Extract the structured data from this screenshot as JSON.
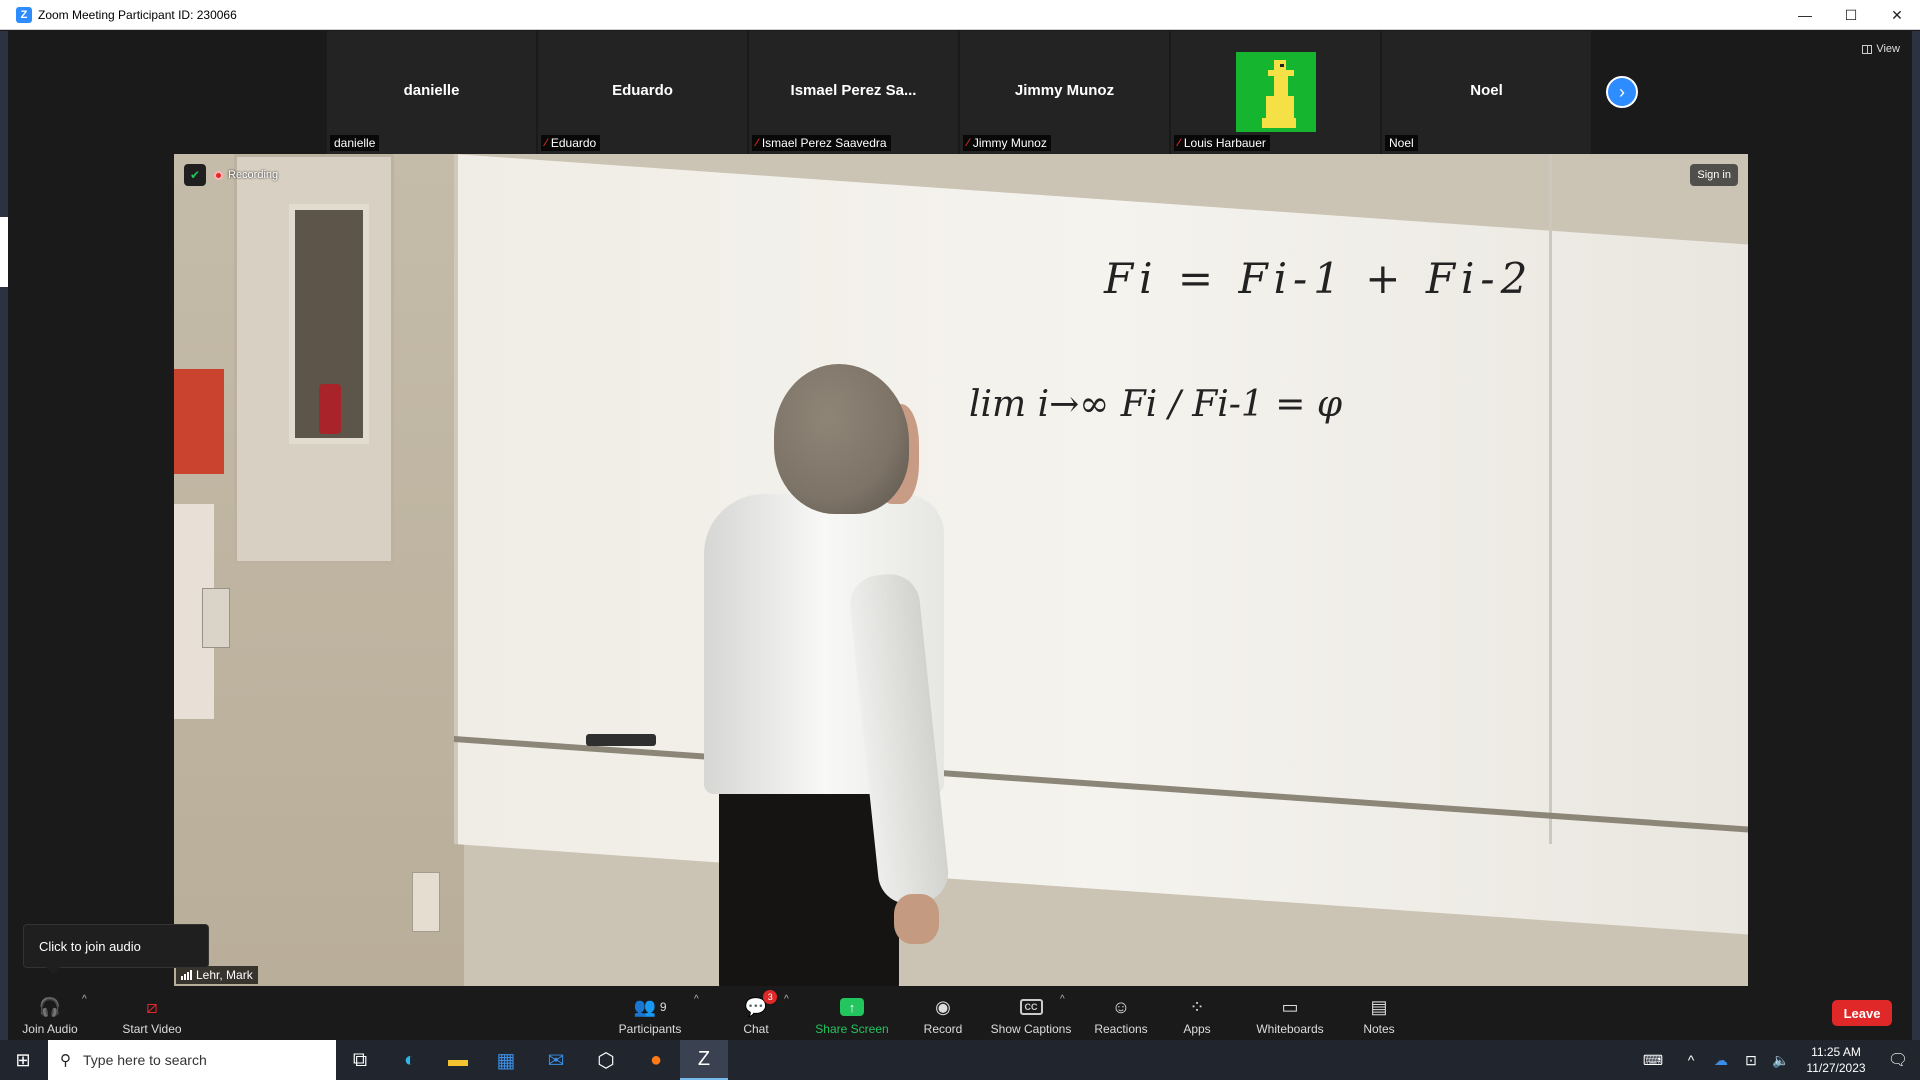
{
  "window": {
    "title": "Zoom Meeting Participant ID: 230066",
    "minimize_glyph": "—",
    "maximize_glyph": "☐",
    "close_glyph": "✕"
  },
  "view_button": {
    "label": "View"
  },
  "participants_strip": [
    {
      "display_name": "danielle",
      "tag": "danielle",
      "muted": false,
      "has_avatar": false
    },
    {
      "display_name": "Eduardo",
      "tag": "Eduardo",
      "muted": true,
      "has_avatar": false
    },
    {
      "display_name": "Ismael Perez Sa...",
      "tag": "Ismael Perez Saavedra",
      "muted": true,
      "has_avatar": false
    },
    {
      "display_name": "Jimmy Munoz",
      "tag": "Jimmy Munoz",
      "muted": true,
      "has_avatar": false
    },
    {
      "display_name": "",
      "tag": "Louis Harbauer",
      "muted": true,
      "has_avatar": true
    },
    {
      "display_name": "Noel",
      "tag": "Noel",
      "muted": false,
      "has_avatar": false
    }
  ],
  "main_video": {
    "recording_label": "Recording",
    "sign_in_label": "Sign in",
    "speaker_name": "Lehr, Mark",
    "board_formula_1": "Fi = Fi-1 + Fi-2",
    "board_formula_2": "lim i→∞  Fi / Fi-1 = φ"
  },
  "tooltip": {
    "text": "Click to join audio"
  },
  "toolbar": {
    "join_audio": "Join Audio",
    "start_video": "Start Video",
    "participants": "Participants",
    "participants_count": "9",
    "chat": "Chat",
    "chat_badge": "3",
    "share_screen": "Share Screen",
    "record": "Record",
    "show_captions": "Show Captions",
    "captions_icon_text": "CC",
    "reactions": "Reactions",
    "apps": "Apps",
    "whiteboards": "Whiteboards",
    "notes": "Notes",
    "leave": "Leave"
  },
  "taskbar": {
    "search_placeholder": "Type here to search",
    "time": "11:25 AM",
    "date": "11/27/2023"
  },
  "colors": {
    "zoom_blue": "#2d8cff",
    "share_green": "#22c55e",
    "leave_red": "#e02828",
    "avatar_green": "#15b52f"
  }
}
